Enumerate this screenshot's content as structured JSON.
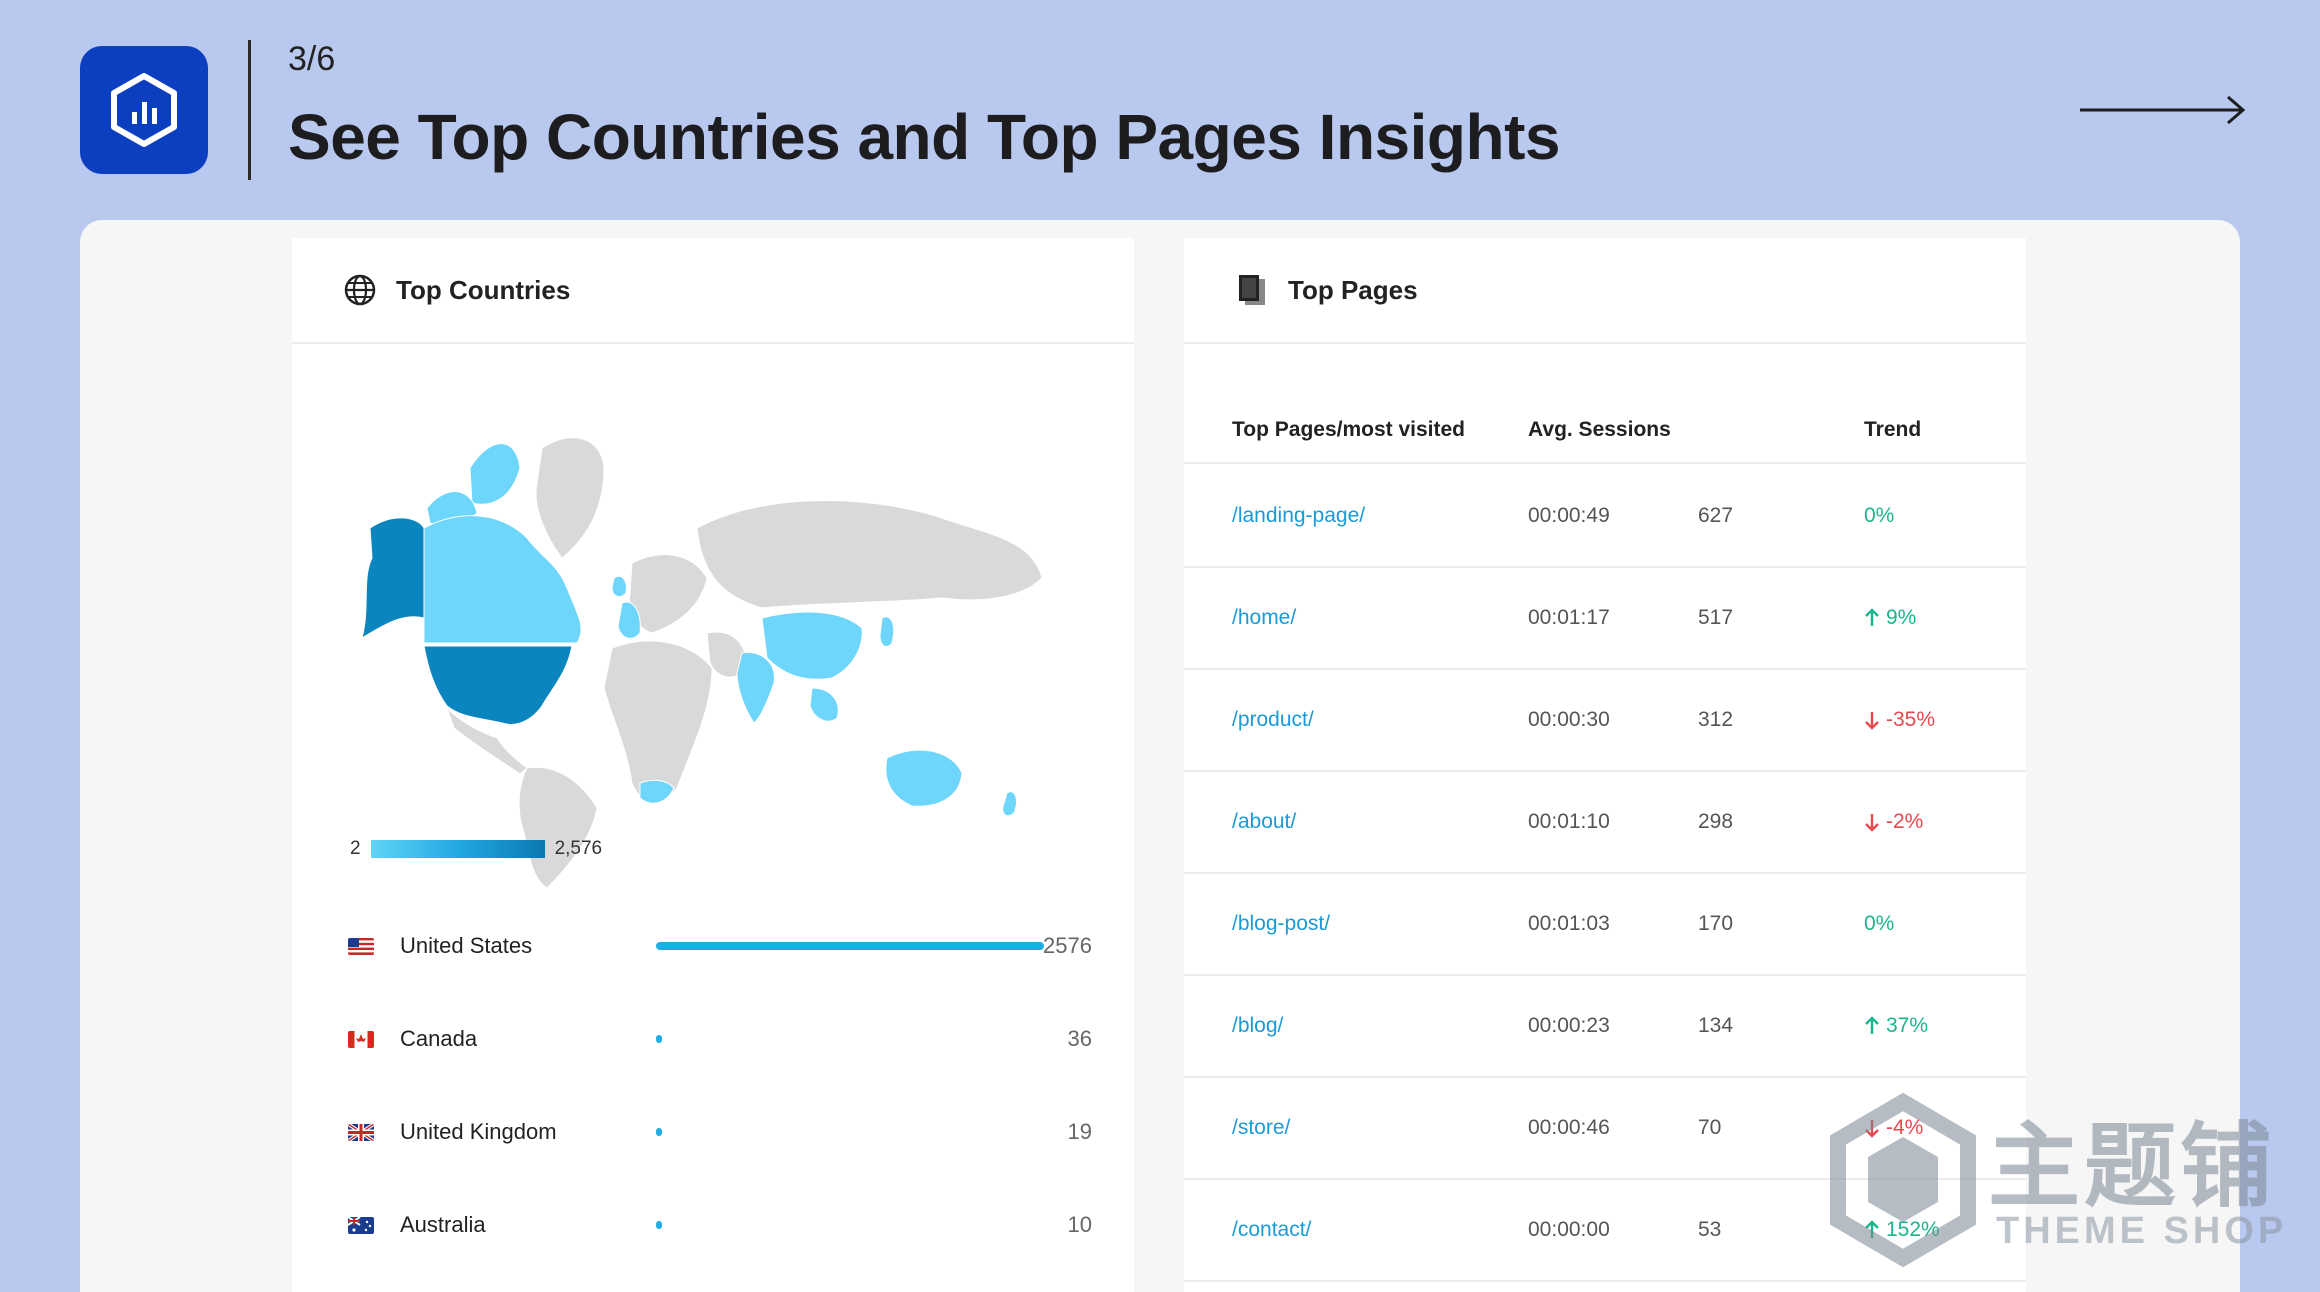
{
  "header": {
    "step": "3/6",
    "title": "See Top Countries and Top Pages Insights",
    "logo_icon": "bar-chart-hexagon-icon",
    "next_icon": "arrow-right-icon"
  },
  "colors": {
    "background": "#b9c8ee",
    "logo": "#0b3fbf",
    "accent": "#1eaee4",
    "link": "#1a9ad6",
    "trend_up": "#19b58c",
    "trend_down": "#e5484d"
  },
  "countries_panel": {
    "title": "Top Countries",
    "icon": "globe-icon",
    "legend_min": "2",
    "legend_max": "2,576",
    "max_value": 2576,
    "items": [
      {
        "name": "United States",
        "value": 2576,
        "display": "2576",
        "flag": "us"
      },
      {
        "name": "Canada",
        "value": 36,
        "display": "36",
        "flag": "ca"
      },
      {
        "name": "United Kingdom",
        "value": 19,
        "display": "19",
        "flag": "uk"
      },
      {
        "name": "Australia",
        "value": 10,
        "display": "10",
        "flag": "au"
      }
    ]
  },
  "pages_panel": {
    "title": "Top Pages",
    "icon": "pages-icon",
    "columns": {
      "page": "Top Pages/most visited",
      "sessions": "Avg. Sessions",
      "trend": "Trend"
    },
    "rows": [
      {
        "page": "/landing-page/",
        "avg": "00:00:49",
        "count": "627",
        "trend": "0%",
        "dir": "flat"
      },
      {
        "page": "/home/",
        "avg": "00:01:17",
        "count": "517",
        "trend": "9%",
        "dir": "up"
      },
      {
        "page": "/product/",
        "avg": "00:00:30",
        "count": "312",
        "trend": "-35%",
        "dir": "down"
      },
      {
        "page": "/about/",
        "avg": "00:01:10",
        "count": "298",
        "trend": "-2%",
        "dir": "down"
      },
      {
        "page": "/blog-post/",
        "avg": "00:01:03",
        "count": "170",
        "trend": "0%",
        "dir": "flat"
      },
      {
        "page": "/blog/",
        "avg": "00:00:23",
        "count": "134",
        "trend": "37%",
        "dir": "up"
      },
      {
        "page": "/store/",
        "avg": "00:00:46",
        "count": "70",
        "trend": "-4%",
        "dir": "down"
      },
      {
        "page": "/contact/",
        "avg": "00:00:00",
        "count": "53",
        "trend": "152%",
        "dir": "up"
      }
    ]
  },
  "watermark": {
    "cn": "主题铺",
    "en": "THEME SHOP"
  }
}
